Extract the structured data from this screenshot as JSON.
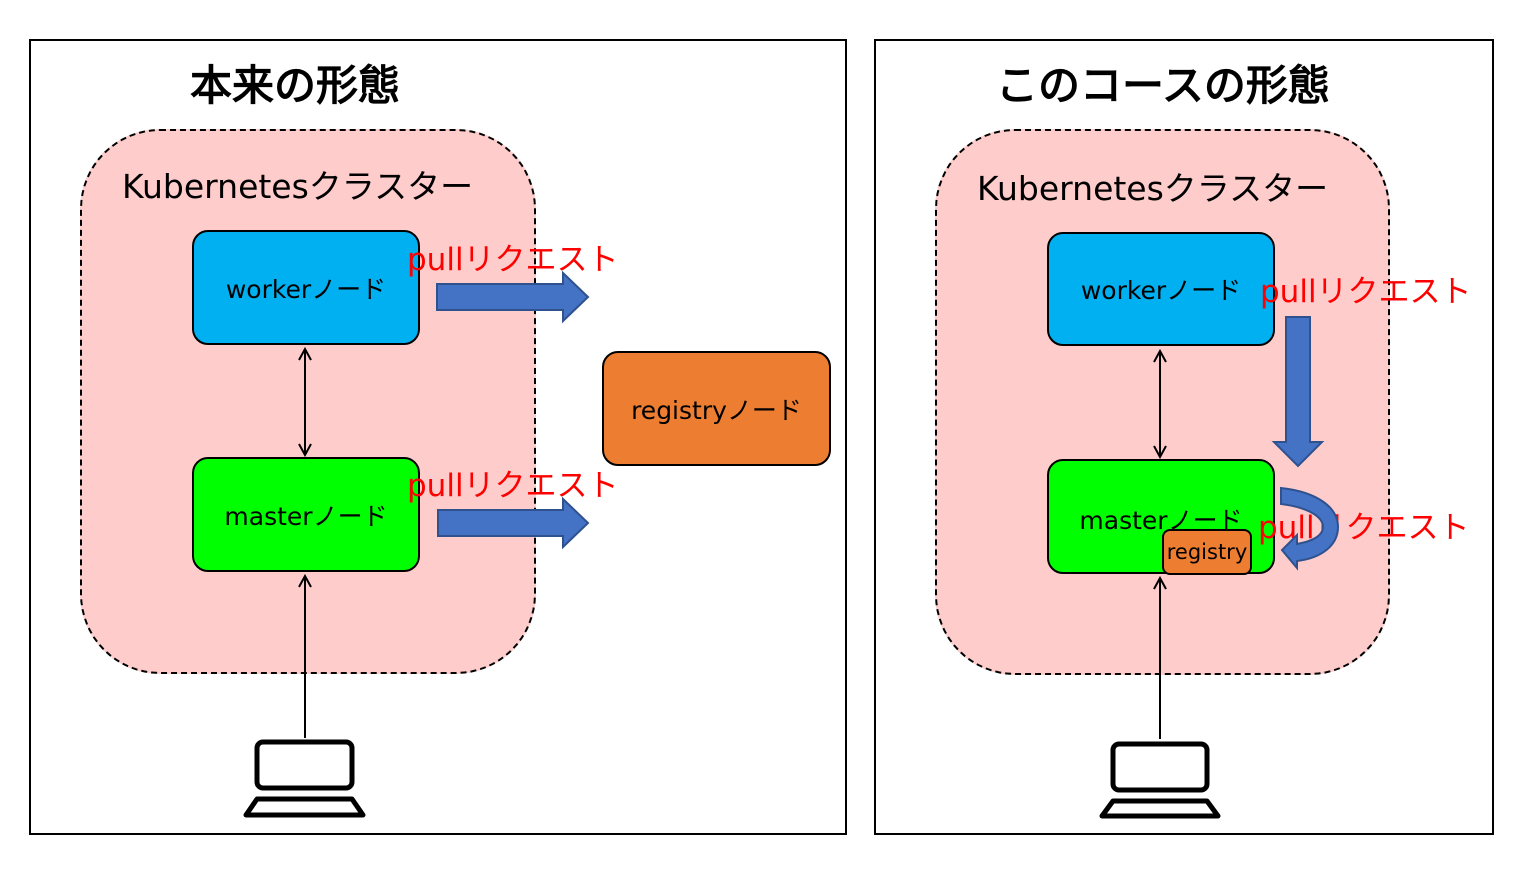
{
  "left": {
    "title": "本来の形態",
    "cluster_label": "Kubernetesクラスター",
    "worker_label": "workerノード",
    "master_label": "masterノード",
    "registry_label": "registryノード",
    "pull_worker": "pullリクエスト",
    "pull_master": "pullリクエスト"
  },
  "right": {
    "title": "このコースの形態",
    "cluster_label": "Kubernetesクラスター",
    "worker_label": "workerノード",
    "master_label": "masterノード",
    "registry_label": "registry",
    "pull_worker": "pullリクエスト",
    "pull_master": "pullリクエスト"
  },
  "colors": {
    "cluster": "#ffcccc",
    "worker": "#00b0f0",
    "master": "#00ff00",
    "registry": "#ed7d31",
    "arrow": "#4472c4",
    "pull_text": "#ff0000"
  },
  "icons": [
    "laptop-icon",
    "laptop-icon"
  ]
}
